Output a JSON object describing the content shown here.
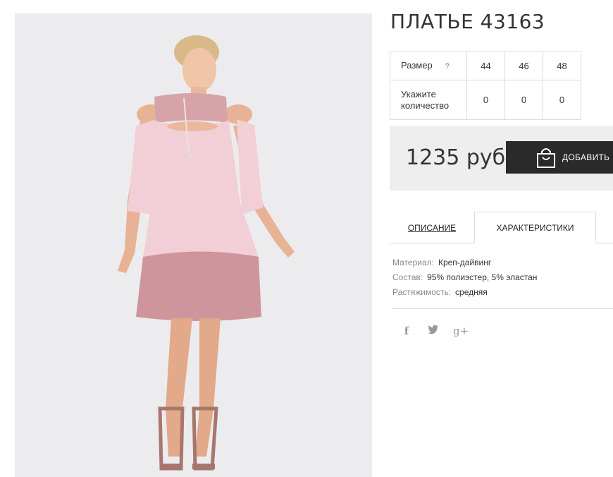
{
  "product": {
    "title": "ПЛАТЬЕ 43163"
  },
  "sizes": {
    "size_label": "Размер",
    "help_mark": "?",
    "qty_label_line1": "Укажите",
    "qty_label_line2": "количество",
    "sizes": [
      "44",
      "46",
      "48"
    ],
    "quantities": [
      "0",
      "0",
      "0"
    ]
  },
  "purchase": {
    "price": "1235 руб",
    "add_label": "ДОБАВИТЬ"
  },
  "tabs": {
    "description": "ОПИСАНИЕ",
    "characteristics": "ХАРАКТЕРИСТИКИ"
  },
  "characteristics": [
    {
      "key": "Материал:",
      "value": "Креп-дайвинг"
    },
    {
      "key": "Состав:",
      "value": "95% полиэстер, 5% эластан"
    },
    {
      "key": "Растяжимость:",
      "value": "средняя"
    }
  ],
  "social": {
    "facebook": "f",
    "twitter": "twitter-icon",
    "google_plus": "g+"
  },
  "colors": {
    "dress_light": "#f2cfd6",
    "dress_ruffle": "#cf959c",
    "button_bg": "#2a2a2a",
    "price_box_bg": "#eeeeee"
  }
}
